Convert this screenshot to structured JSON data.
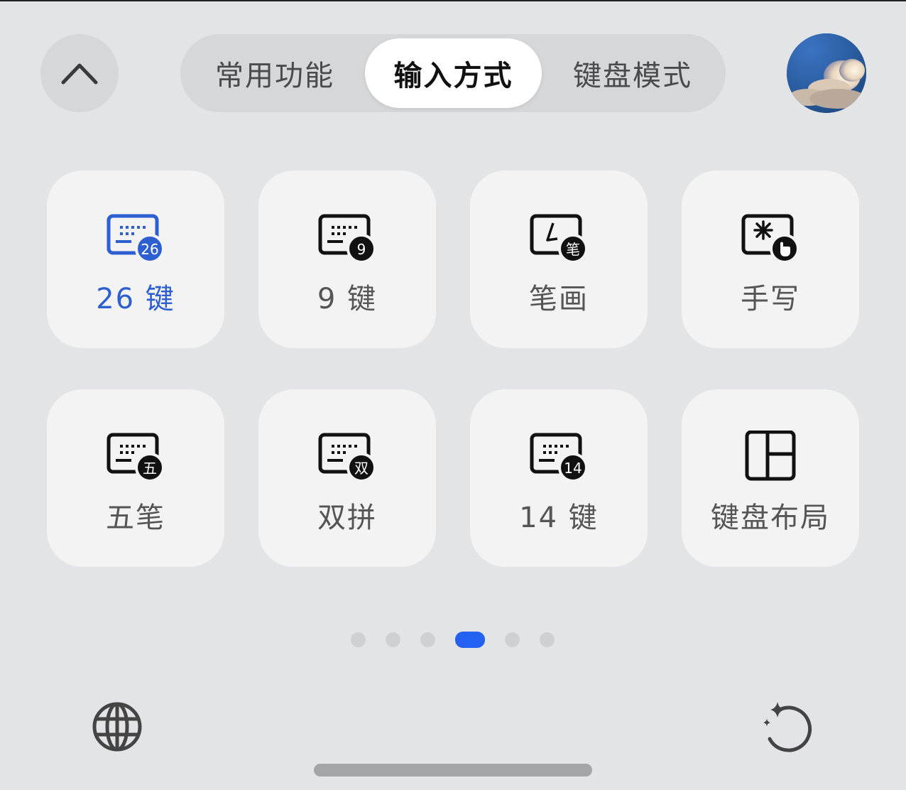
{
  "tabs": [
    {
      "label": "常用功能",
      "active": false
    },
    {
      "label": "输入方式",
      "active": true
    },
    {
      "label": "键盘模式",
      "active": false
    }
  ],
  "tiles": [
    {
      "label": "26 键",
      "badge": "26",
      "icon": "keyboard-26-icon",
      "selected": true
    },
    {
      "label": "9 键",
      "badge": "9",
      "icon": "keyboard-9-icon",
      "selected": false
    },
    {
      "label": "笔画",
      "badge": "笔",
      "icon": "stroke-icon",
      "selected": false
    },
    {
      "label": "手写",
      "badge": "",
      "icon": "handwriting-icon",
      "selected": false
    },
    {
      "label": "五笔",
      "badge": "五",
      "icon": "wubi-icon",
      "selected": false
    },
    {
      "label": "双拼",
      "badge": "双",
      "icon": "shuangpin-icon",
      "selected": false
    },
    {
      "label": "14 键",
      "badge": "14",
      "icon": "keyboard-14-icon",
      "selected": false
    },
    {
      "label": "键盘布局",
      "badge": "",
      "icon": "keyboard-layout-icon",
      "selected": false
    }
  ],
  "pager": {
    "count": 6,
    "active_index": 3
  },
  "colors": {
    "accent": "#2561f0",
    "selected_text": "#2e5fd0",
    "background": "#e3e4e6",
    "tile": "#f3f3f4"
  }
}
